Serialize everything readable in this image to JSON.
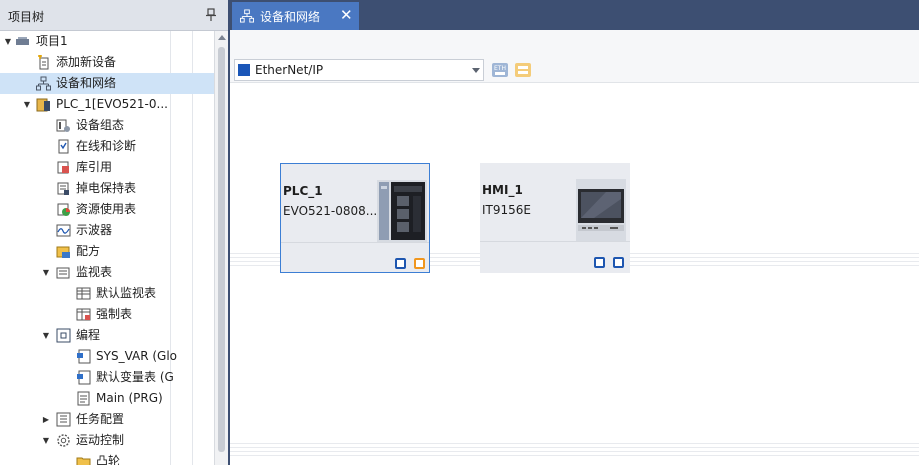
{
  "project_tree": {
    "title": "项目树",
    "pin_icon": "pin-icon",
    "items": [
      {
        "label": "项目1",
        "icon": "project-icon"
      },
      {
        "label": "添加新设备",
        "icon": "add-device-icon"
      },
      {
        "label": "设备和网络",
        "icon": "network-icon"
      },
      {
        "label": "PLC_1[EVO521-0...",
        "icon": "plc-icon"
      },
      {
        "label": "设备组态",
        "icon": "device-config-icon"
      },
      {
        "label": "在线和诊断",
        "icon": "diagnostics-icon"
      },
      {
        "label": "库引用",
        "icon": "library-icon"
      },
      {
        "label": "掉电保持表",
        "icon": "retain-table-icon"
      },
      {
        "label": "资源使用表",
        "icon": "resource-usage-icon"
      },
      {
        "label": "示波器",
        "icon": "oscilloscope-icon"
      },
      {
        "label": "配方",
        "icon": "recipe-icon"
      },
      {
        "label": "监视表",
        "icon": "watch-folder-icon"
      },
      {
        "label": "默认监视表",
        "icon": "watch-table-icon"
      },
      {
        "label": "强制表",
        "icon": "force-table-icon"
      },
      {
        "label": "编程",
        "icon": "programming-icon"
      },
      {
        "label": "SYS_VAR (Glo",
        "icon": "global-var-icon"
      },
      {
        "label": "默认变量表 (G",
        "icon": "global-var-icon"
      },
      {
        "label": "Main (PRG)",
        "icon": "program-icon"
      },
      {
        "label": "任务配置",
        "icon": "task-config-icon"
      },
      {
        "label": "运动控制",
        "icon": "motion-control-icon"
      },
      {
        "label": "凸轮",
        "icon": "cam-folder-icon"
      }
    ]
  },
  "editor": {
    "tab_label": "设备和网络",
    "tab_close": "✕",
    "protocol": {
      "selected": "EtherNet/IP",
      "swatch_color": "#1a56b8"
    },
    "devices": [
      {
        "name": "PLC_1",
        "model": "EVO521-0808...",
        "ports": [
          "#1e56b0",
          "#f0961e"
        ]
      },
      {
        "name": "HMI_1",
        "model": "IT9156E",
        "ports": [
          "#1e56b0",
          "#1e56b0"
        ]
      }
    ]
  },
  "colors": {
    "tab_active": "#4a78c2",
    "tabbar": "#3d4f72",
    "selection": "#cfe3f7",
    "device_border": "#3c7ed4"
  }
}
